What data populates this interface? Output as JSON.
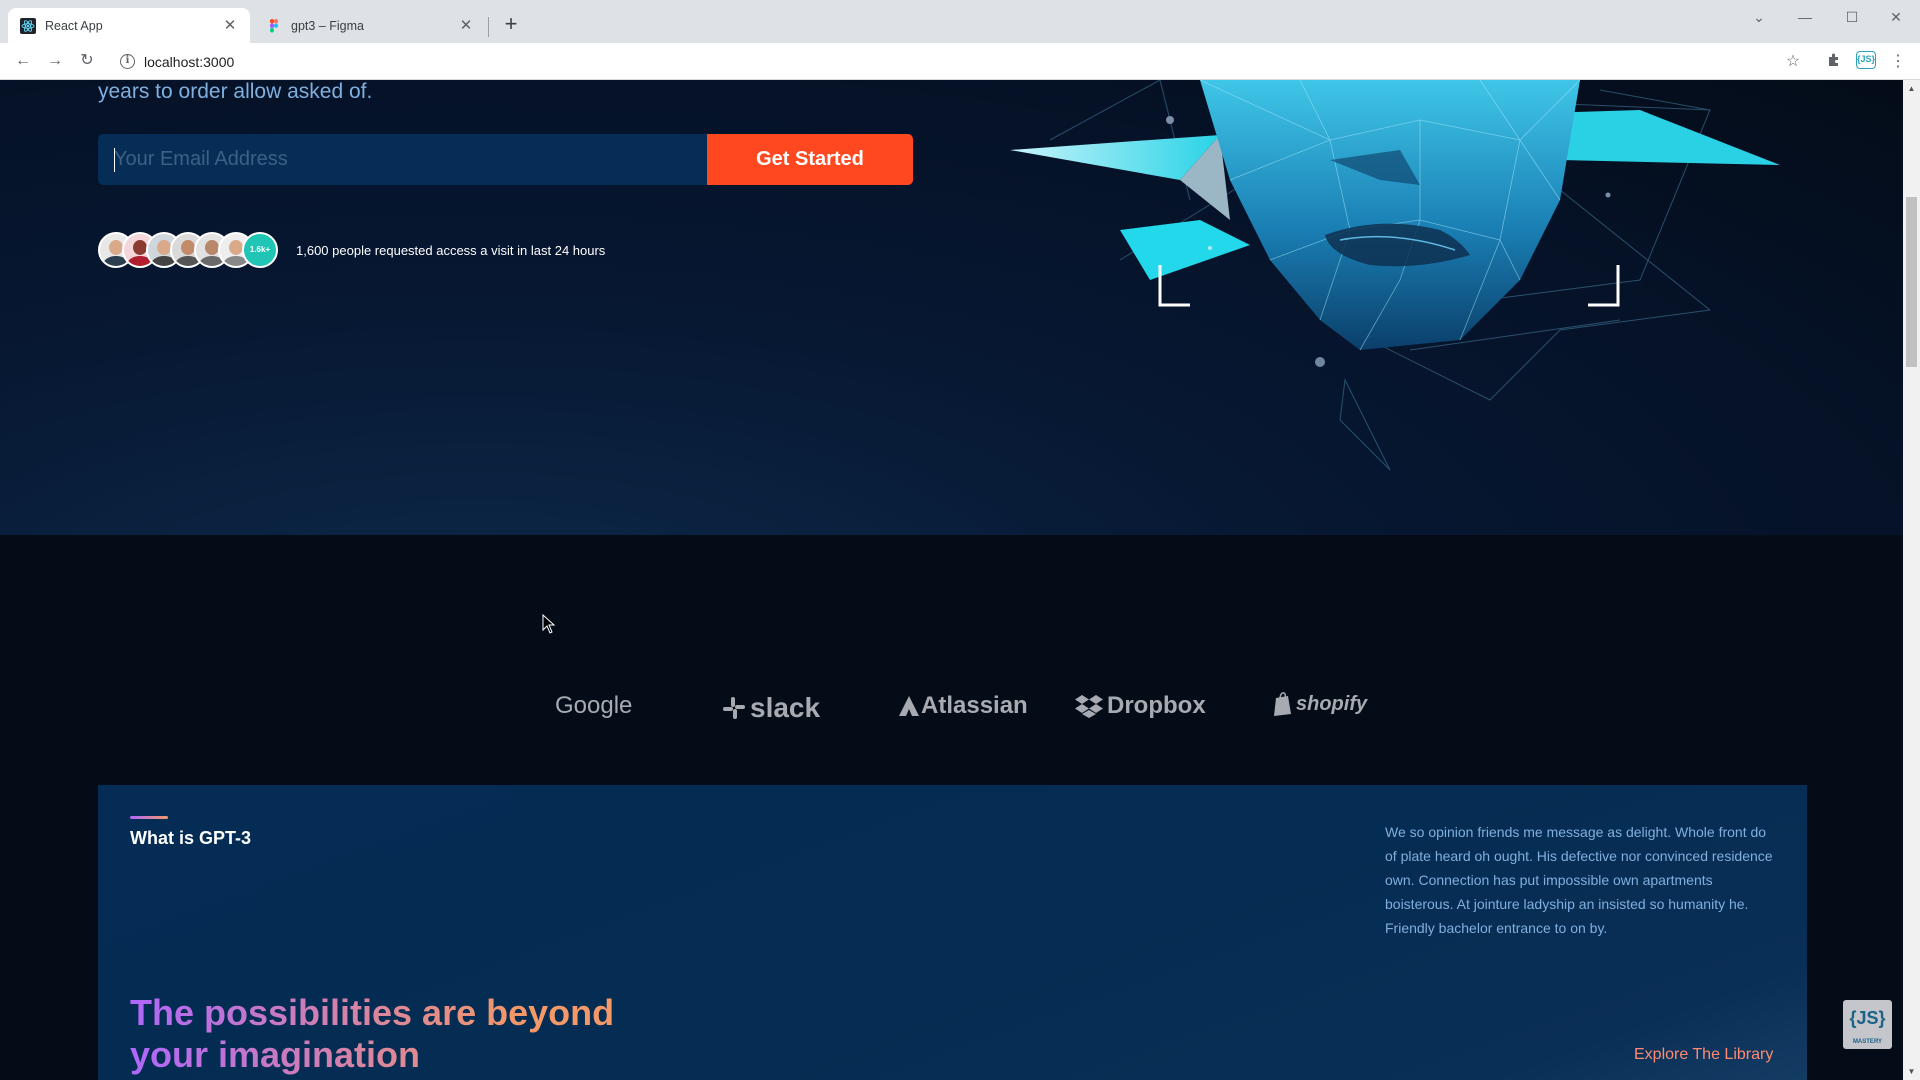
{
  "browser": {
    "tabs": [
      {
        "title": "React App",
        "active": true
      },
      {
        "title": "gpt3 – Figma",
        "active": false
      }
    ],
    "url": "localhost:3000"
  },
  "hero": {
    "text_fragment": "years to order allow asked of.",
    "email_placeholder": "Your Email Address",
    "cta_label": "Get Started",
    "avatar_count_label": "1.6k+",
    "access_text": "1,600 people requested access a visit in last 24 hours"
  },
  "brands": [
    "Google",
    "slack",
    "Atlassian",
    "Dropbox",
    "shopify"
  ],
  "gpt_section": {
    "title": "What is GPT-3",
    "description": "We so opinion friends me message as delight. Whole front do of plate heard oh ought. His defective nor convinced residence own. Connection has put impossible own apartments boisterous. At jointure ladyship an insisted so humanity he. Friendly bachelor entrance to on by.",
    "headline": "The possibilities are beyond your imagination",
    "explore_label": "Explore The Library"
  },
  "badge": {
    "label": "{JS}",
    "sub": "MASTERY"
  },
  "colors": {
    "background": "#040c18",
    "cta": "#ff4820",
    "section_bg": "#042c54",
    "text_muted": "#81afdd",
    "gradient_start": "#ae67fa",
    "gradient_end": "#f49867",
    "explore": "#ff8a71"
  },
  "icons": [
    "react-favicon",
    "figma-favicon",
    "close-icon",
    "new-tab-icon",
    "back-arrow-icon",
    "forward-arrow-icon",
    "reload-icon",
    "info-icon",
    "star-icon",
    "extensions-icon",
    "menu-icon",
    "chevron-down-icon",
    "minimize-icon",
    "maximize-icon",
    "window-close-icon"
  ]
}
